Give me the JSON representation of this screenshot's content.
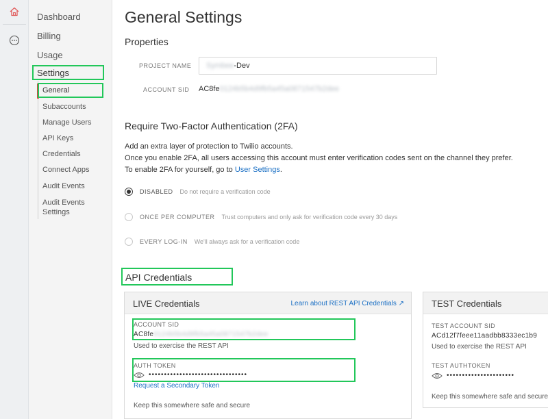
{
  "rail": {
    "home_icon": "home-icon",
    "more_icon": "more-icon"
  },
  "sidebar": {
    "top_items": [
      "Dashboard",
      "Billing",
      "Usage",
      "Settings"
    ],
    "sub_items": [
      "General",
      "Subaccounts",
      "Manage Users",
      "API Keys",
      "Credentials",
      "Connect Apps",
      "Audit Events",
      "Audit Events Settings"
    ]
  },
  "page": {
    "title": "General Settings"
  },
  "properties": {
    "heading": "Properties",
    "project_name_label": "PROJECT NAME",
    "project_name_blur": "Symbee",
    "project_name_suffix": "-Dev",
    "account_sid_label": "ACCOUNT SID",
    "account_sid_prefix": "AC8fe",
    "account_sid_blur": "0124b5b4d9fb5a45a0871547b2dee"
  },
  "twofa": {
    "heading": "Require Two-Factor Authentication (2FA)",
    "line1": "Add an extra layer of protection to Twilio accounts.",
    "line2": "Once you enable 2FA, all users accessing this account must enter verification codes sent on the channel they prefer.",
    "line3_prefix": "To enable 2FA for yourself, go to ",
    "line3_link": "User Settings",
    "line3_suffix": ".",
    "options": [
      {
        "label": "DISABLED",
        "desc": "Do not require a verification code",
        "checked": true
      },
      {
        "label": "ONCE PER COMPUTER",
        "desc": "Trust computers and only ask for verification code every 30 days",
        "checked": false
      },
      {
        "label": "EVERY LOG-IN",
        "desc": "We'll always ask for a verification code",
        "checked": false
      }
    ]
  },
  "api": {
    "heading": "API Credentials",
    "live": {
      "title": "LIVE Credentials",
      "learn_link": "Learn about REST API Credentials ↗",
      "sid_label": "ACCOUNT SID",
      "sid_prefix": "AC8fe",
      "sid_blur": "0124b5b4d9fb5a45a0871547b2dee",
      "sid_note": "Used to exercise the REST API",
      "token_label": "AUTH TOKEN",
      "token_dots": "••••••••••••••••••••••••••••••••",
      "secondary_link": "Request a Secondary Token",
      "safe_note": "Keep this somewhere safe and secure"
    },
    "test": {
      "title": "TEST Credentials",
      "sid_label": "TEST ACCOUNT SID",
      "sid_value": "ACd12f7feee11aadbb8333ec1b9",
      "sid_note": "Used to exercise the REST API",
      "token_label": "TEST AUTHTOKEN",
      "token_dots": "••••••••••••••••••••••",
      "safe_note": "Keep this somewhere safe and secure"
    }
  },
  "colors": {
    "accent_link": "#1a6fc4",
    "active_marker": "#e03e3e",
    "highlight": "#22c75a",
    "home_icon": "#e05a5a"
  }
}
